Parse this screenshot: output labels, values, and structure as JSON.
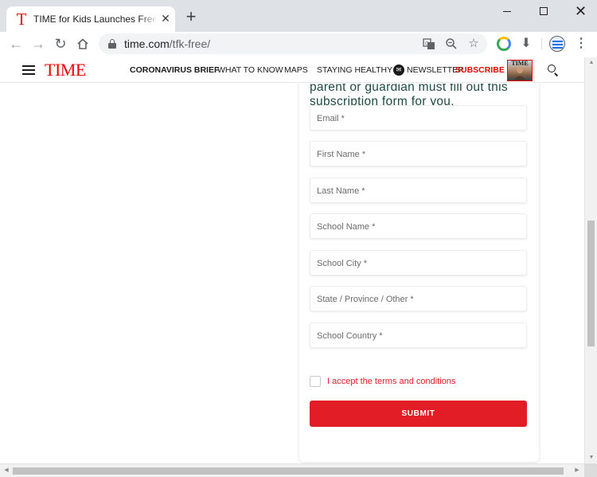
{
  "browser": {
    "tab_title": "TIME for Kids Launches Free Di",
    "tab_favicon": "T",
    "tab_close": "✕",
    "new_tab": "+",
    "url_host": "time.com",
    "url_path": "/tfk-free/",
    "icons": {
      "back": "arrow-left-icon",
      "forward": "arrow-right-icon",
      "reload": "reload-icon",
      "home": "home-icon",
      "lock": "lock-icon",
      "translate": "translate-icon",
      "zoom": "zoom-out-icon",
      "bookmark": "star-icon",
      "extension": "extension-icon",
      "download": "download-icon",
      "profile": "profile-icon",
      "menu": "more-vertical-icon"
    },
    "window_controls": [
      "minimize",
      "maximize",
      "close"
    ]
  },
  "site_header": {
    "logo": "TIME",
    "nav": [
      "CORONAVIRUS BRIEF",
      "WHAT TO KNOW",
      "MAPS",
      "STAYING HEALTHY"
    ],
    "newsletter": "NEWSLETTER",
    "subscribe": "SUBSCRIBE",
    "cover_title": "TIME",
    "colors": {
      "brand_red": "#e90606"
    }
  },
  "form": {
    "heading": "parent or guardian must fill out this subscription form for you.",
    "fields": [
      "Email *",
      "First Name *",
      "Last Name *",
      "School Name *",
      "School City *",
      "State / Province / Other *",
      "School Country *"
    ],
    "terms_label": "I accept the terms and conditions",
    "terms_checked": false,
    "submit_label": "SUBMIT",
    "colors": {
      "accent": "#e31d25",
      "heading": "#1f4b45"
    }
  }
}
